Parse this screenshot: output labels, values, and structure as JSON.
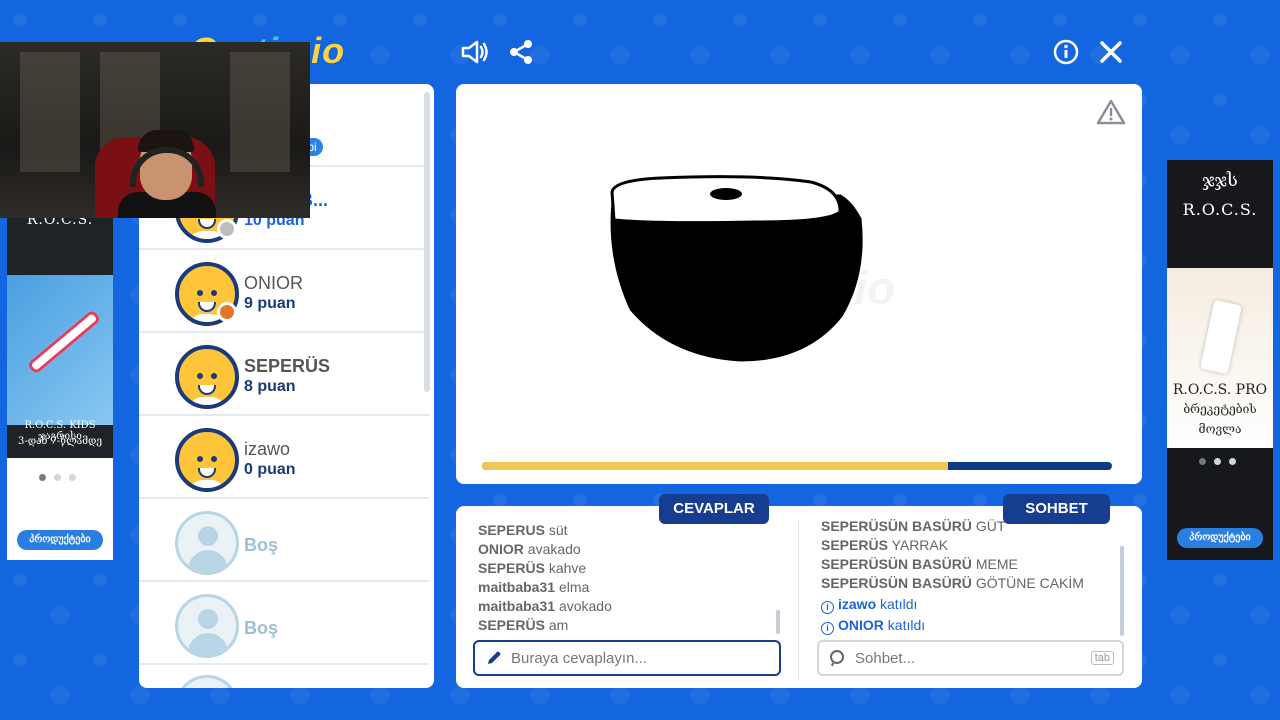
{
  "header": {
    "logo": "Gartic.io",
    "logo_prefix": "Gar",
    "logo_mid": "tic",
    "logo_suffix": ".io"
  },
  "players": [
    {
      "name": "maitbaba31",
      "name_visible": "ba31",
      "badge": "hibi",
      "score": ""
    },
    {
      "name": "SEPERÜSÜN B...",
      "name_visible": "ÜSÜN B...",
      "score": "10 puan",
      "status_color": "#bdbdbd"
    },
    {
      "name": "ONIOR",
      "score": "9 puan",
      "status_color": "#e8742a"
    },
    {
      "name": "SEPERÜS",
      "score": "8 puan"
    },
    {
      "name": "izawo",
      "score": "0 puan"
    },
    {
      "name": "Boş"
    },
    {
      "name": "Boş"
    }
  ],
  "round_progress": 0.74,
  "tabs": {
    "answers": "CEVAPLAR",
    "chat": "SOHBET"
  },
  "answers": [
    {
      "user": "SEPERUS",
      "text": "süt"
    },
    {
      "user": "ONIOR",
      "text": "avakado"
    },
    {
      "user": "SEPERÜS",
      "text": "kahve"
    },
    {
      "user": "maitbaba31",
      "text": "elma"
    },
    {
      "user": "maitbaba31",
      "text": "avokado"
    },
    {
      "user": "SEPERÜS",
      "text": "am"
    }
  ],
  "chat": [
    {
      "user": "SEPERÜSÜN BASÜRÜ",
      "text": "GÜT"
    },
    {
      "user": "SEPERÜS",
      "text": "YARRAK"
    },
    {
      "user": "SEPERÜSÜN BASÜRÜ",
      "text": "MEME"
    },
    {
      "user": "SEPERÜSÜN BASÜRÜ",
      "text": "GÖTÜNE CAKİM"
    },
    {
      "user": "izawo",
      "text": "katıldı",
      "join": true
    },
    {
      "user": "ONIOR",
      "text": "katıldı",
      "join": true
    }
  ],
  "answer_input": {
    "placeholder": "Buraya cevaplayın..."
  },
  "chat_input": {
    "placeholder": "Sohbet...",
    "hint": "tab"
  },
  "ads": {
    "left": {
      "brand": "R.O.C.S.",
      "line1": "R.O.C.S. KIDS ჯაგრისი",
      "line2": "3-დან 7-წლამდე",
      "button": "პროდუქტები"
    },
    "right": {
      "logo": "ჯჯს",
      "brand": "R.O.C.S.",
      "line1": "R.O.C.S. PRO",
      "line2": "ბრეკეტების",
      "line3": "მოვლა",
      "button": "პროდუქტები"
    }
  },
  "colors": {
    "background": "#1466e0",
    "navy": "#163d8f",
    "progress_fill": "#f0c654",
    "progress_track": "#103a85"
  }
}
